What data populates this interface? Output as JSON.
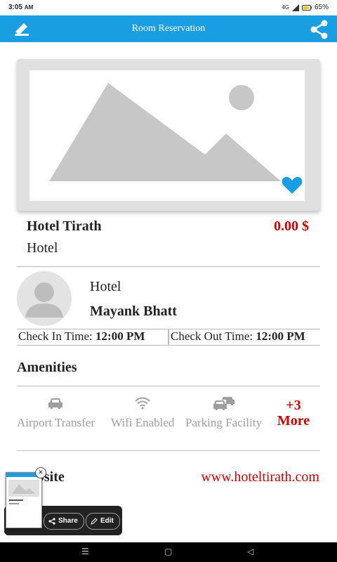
{
  "status": {
    "time": "3:05",
    "time_suffix": "AM",
    "network": "4G",
    "battery": "65%"
  },
  "app_bar": {
    "title": "Room Reservation"
  },
  "hotel": {
    "name": "Hotel Tirath",
    "price": "0.00 $",
    "type": "Hotel"
  },
  "owner": {
    "role": "Hotel",
    "name": "Mayank Bhatt"
  },
  "times": {
    "check_in_label": "Check In Time:",
    "check_in_value": "12:00 PM",
    "check_out_label": "Check Out Time:",
    "check_out_value": "12:00 PM"
  },
  "amenities": {
    "heading": "Amenities",
    "items": [
      {
        "label": "Airport Transfer",
        "icon": "car-icon"
      },
      {
        "label": "Wifi Enabled",
        "icon": "wifi-icon"
      },
      {
        "label": "Parking Facility",
        "icon": "parking-icon"
      }
    ],
    "more_line1": "+3",
    "more_line2": "More"
  },
  "website": {
    "label": "Website",
    "url": "www.hoteltirath.com"
  },
  "screenshot_toolbar": {
    "share_label": "Share",
    "edit_label": "Edit"
  },
  "colors": {
    "accent": "#1a9ee2",
    "price_red": "#cc0000",
    "muted": "#9e9e9e"
  }
}
